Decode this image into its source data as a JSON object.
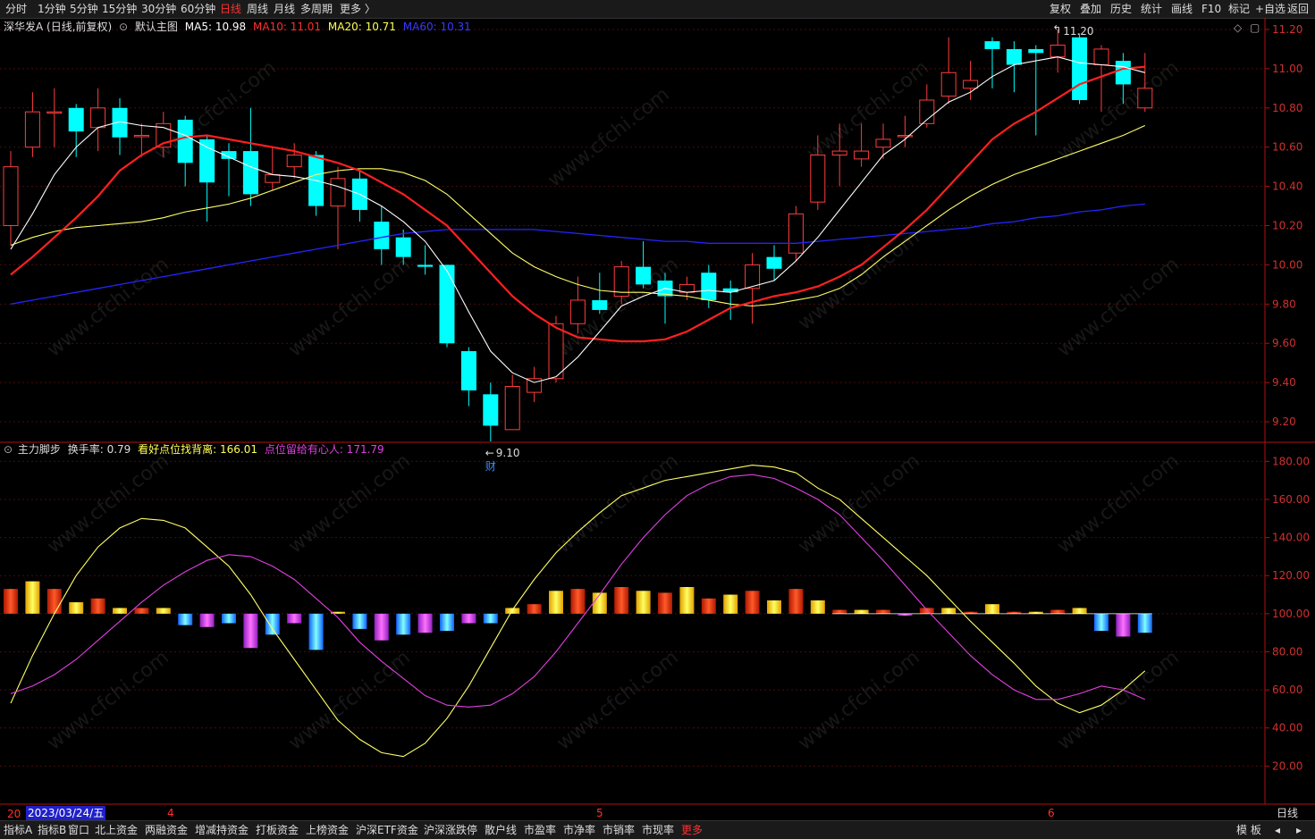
{
  "top_menu": {
    "left": [
      "分时",
      "1分钟",
      "5分钟",
      "15分钟",
      "30分钟",
      "60分钟",
      "日线",
      "周线",
      "月线",
      "多周期",
      "更多 〉"
    ],
    "active": "日线",
    "right": [
      "复权",
      "叠加",
      "历史",
      "统计",
      "画线",
      "F10",
      "标记",
      "+自选",
      "返回"
    ]
  },
  "main_legend": {
    "stock": "深华发A (日线,前复权)",
    "template": "默认主图",
    "ma5": "MA5: 10.98",
    "ma10": "MA10: 11.01",
    "ma20": "MA20: 10.71",
    "ma60": "MA60: 10.31"
  },
  "sub_legend": {
    "name": "主力脚步",
    "turnover": "换手率: 0.79",
    "line1": "看好点位找背离: 166.01",
    "line2": "点位留给有心人: 171.79"
  },
  "watermark": "www.cfchi.com",
  "price_axis": [
    "11.20",
    "11.00",
    "10.80",
    "10.60",
    "10.40",
    "10.20",
    "10.00",
    "9.80",
    "9.60",
    "9.40",
    "9.20"
  ],
  "indicator_axis": [
    "180.00",
    "160.00",
    "140.00",
    "120.00",
    "100.00",
    "80.00",
    "60.00",
    "40.00",
    "20.00"
  ],
  "annotations": {
    "high": "11.20",
    "low": "9.10",
    "event": "财"
  },
  "date_axis": {
    "cursor_date": "2023/03/24/五",
    "cursor_prefix": "20",
    "months": [
      "4",
      "5",
      "6"
    ],
    "period": "日线"
  },
  "bottom_tabs": [
    "指标A",
    "指标B",
    "窗口",
    "北上资金",
    "两融资金",
    "增减持资金",
    "打板资金",
    "上榜资金",
    "沪深ETF资金",
    "沪深涨跌停",
    "散户线",
    "市盈率",
    "市净率",
    "市销率",
    "市现率",
    "更多"
  ],
  "bottom_right": [
    "模 板",
    "◂",
    "▸"
  ],
  "colors": {
    "up": "#ff3d3d",
    "down": "#00ffff",
    "ma5": "#ffffff",
    "ma10": "#ff2020",
    "ma20": "#ffff66",
    "ma60": "#2424ff",
    "line1": "#ffff66",
    "line2": "#e040e0",
    "axis": "#b01010"
  },
  "chart_data": [
    {
      "type": "candlestick",
      "title": "深华发A (日线,前复权)",
      "ylim": [
        9.1,
        11.25
      ],
      "candles": [
        {
          "o": 10.2,
          "c": 10.5,
          "h": 10.58,
          "l": 10.1
        },
        {
          "o": 10.6,
          "c": 10.78,
          "h": 10.88,
          "l": 10.55
        },
        {
          "o": 10.78,
          "c": 10.78,
          "h": 10.9,
          "l": 10.6
        },
        {
          "o": 10.8,
          "c": 10.68,
          "h": 10.82,
          "l": 10.55
        },
        {
          "o": 10.7,
          "c": 10.8,
          "h": 10.9,
          "l": 10.58
        },
        {
          "o": 10.8,
          "c": 10.65,
          "h": 10.85,
          "l": 10.56
        },
        {
          "o": 10.66,
          "c": 10.66,
          "h": 10.72,
          "l": 10.55
        },
        {
          "o": 10.6,
          "c": 10.72,
          "h": 10.78,
          "l": 10.55
        },
        {
          "o": 10.74,
          "c": 10.52,
          "h": 10.76,
          "l": 10.4
        },
        {
          "o": 10.64,
          "c": 10.42,
          "h": 10.66,
          "l": 10.22
        },
        {
          "o": 10.58,
          "c": 10.54,
          "h": 10.62,
          "l": 10.35
        },
        {
          "o": 10.58,
          "c": 10.36,
          "h": 10.8,
          "l": 10.3
        },
        {
          "o": 10.42,
          "c": 10.46,
          "h": 10.6,
          "l": 10.38
        },
        {
          "o": 10.5,
          "c": 10.56,
          "h": 10.62,
          "l": 10.44
        },
        {
          "o": 10.56,
          "c": 10.3,
          "h": 10.58,
          "l": 10.25
        },
        {
          "o": 10.3,
          "c": 10.44,
          "h": 10.5,
          "l": 10.08
        },
        {
          "o": 10.44,
          "c": 10.28,
          "h": 10.48,
          "l": 10.22
        },
        {
          "o": 10.22,
          "c": 10.08,
          "h": 10.3,
          "l": 10.0
        },
        {
          "o": 10.14,
          "c": 10.04,
          "h": 10.18,
          "l": 10.0
        },
        {
          "o": 10.0,
          "c": 9.99,
          "h": 10.1,
          "l": 9.95
        },
        {
          "o": 10.0,
          "c": 9.6,
          "h": 10.0,
          "l": 9.58
        },
        {
          "o": 9.56,
          "c": 9.36,
          "h": 9.58,
          "l": 9.28
        },
        {
          "o": 9.34,
          "c": 9.18,
          "h": 9.4,
          "l": 9.1
        },
        {
          "o": 9.16,
          "c": 9.38,
          "h": 9.44,
          "l": 9.16
        },
        {
          "o": 9.35,
          "c": 9.42,
          "h": 9.48,
          "l": 9.3
        },
        {
          "o": 9.42,
          "c": 9.7,
          "h": 9.74,
          "l": 9.4
        },
        {
          "o": 9.7,
          "c": 9.82,
          "h": 9.94,
          "l": 9.65
        },
        {
          "o": 9.82,
          "c": 9.77,
          "h": 9.96,
          "l": 9.75
        },
        {
          "o": 9.84,
          "c": 9.99,
          "h": 10.02,
          "l": 9.8
        },
        {
          "o": 9.99,
          "c": 9.9,
          "h": 10.12,
          "l": 9.88
        },
        {
          "o": 9.92,
          "c": 9.84,
          "h": 9.96,
          "l": 9.7
        },
        {
          "o": 9.86,
          "c": 9.9,
          "h": 9.94,
          "l": 9.82
        },
        {
          "o": 9.96,
          "c": 9.82,
          "h": 10.0,
          "l": 9.78
        },
        {
          "o": 9.88,
          "c": 9.86,
          "h": 9.92,
          "l": 9.72
        },
        {
          "o": 9.88,
          "c": 10.0,
          "h": 10.06,
          "l": 9.7
        },
        {
          "o": 10.04,
          "c": 9.98,
          "h": 10.1,
          "l": 9.92
        },
        {
          "o": 10.06,
          "c": 10.26,
          "h": 10.3,
          "l": 10.02
        },
        {
          "o": 10.32,
          "c": 10.56,
          "h": 10.66,
          "l": 10.28
        },
        {
          "o": 10.56,
          "c": 10.58,
          "h": 10.72,
          "l": 10.4
        },
        {
          "o": 10.54,
          "c": 10.58,
          "h": 10.72,
          "l": 10.5
        },
        {
          "o": 10.6,
          "c": 10.64,
          "h": 10.72,
          "l": 10.54
        },
        {
          "o": 10.66,
          "c": 10.66,
          "h": 10.76,
          "l": 10.6
        },
        {
          "o": 10.72,
          "c": 10.84,
          "h": 10.92,
          "l": 10.7
        },
        {
          "o": 10.86,
          "c": 10.98,
          "h": 11.16,
          "l": 10.82
        },
        {
          "o": 10.9,
          "c": 10.94,
          "h": 11.04,
          "l": 10.84
        },
        {
          "o": 11.14,
          "c": 11.1,
          "h": 11.16,
          "l": 10.9
        },
        {
          "o": 11.1,
          "c": 11.02,
          "h": 11.14,
          "l": 10.88
        },
        {
          "o": 11.1,
          "c": 11.08,
          "h": 11.12,
          "l": 10.66
        },
        {
          "o": 11.06,
          "c": 11.12,
          "h": 11.2,
          "l": 10.98
        },
        {
          "o": 11.16,
          "c": 10.84,
          "h": 11.18,
          "l": 10.82
        },
        {
          "o": 11.02,
          "c": 11.1,
          "h": 11.12,
          "l": 10.78
        },
        {
          "o": 11.04,
          "c": 10.92,
          "h": 11.08,
          "l": 10.82
        },
        {
          "o": 10.8,
          "c": 10.9,
          "h": 11.08,
          "l": 10.78
        }
      ],
      "ma5": [
        10.08,
        10.26,
        10.46,
        10.6,
        10.7,
        10.73,
        10.71,
        10.7,
        10.66,
        10.6,
        10.55,
        10.5,
        10.46,
        10.45,
        10.43,
        10.4,
        10.36,
        10.3,
        10.22,
        10.12,
        9.97,
        9.76,
        9.56,
        9.45,
        9.4,
        9.43,
        9.53,
        9.66,
        9.79,
        9.84,
        9.88,
        9.86,
        9.87,
        9.86,
        9.89,
        9.92,
        10.02,
        10.14,
        10.28,
        10.42,
        10.56,
        10.64,
        10.74,
        10.83,
        10.88,
        10.96,
        11.02,
        11.04,
        11.06,
        11.03,
        11.02,
        11.01,
        10.98
      ],
      "ma10": [
        9.95,
        10.04,
        10.14,
        10.24,
        10.35,
        10.48,
        10.56,
        10.62,
        10.65,
        10.66,
        10.64,
        10.62,
        10.6,
        10.58,
        10.55,
        10.52,
        10.48,
        10.42,
        10.36,
        10.28,
        10.2,
        10.08,
        9.96,
        9.84,
        9.75,
        9.68,
        9.63,
        9.62,
        9.61,
        9.61,
        9.62,
        9.66,
        9.72,
        9.78,
        9.81,
        9.84,
        9.86,
        9.89,
        9.94,
        10.0,
        10.09,
        10.18,
        10.28,
        10.4,
        10.52,
        10.64,
        10.72,
        10.78,
        10.85,
        10.92,
        10.96,
        11.0,
        11.01
      ],
      "ma20": [
        10.1,
        10.14,
        10.17,
        10.19,
        10.2,
        10.21,
        10.22,
        10.24,
        10.27,
        10.29,
        10.31,
        10.34,
        10.38,
        10.42,
        10.46,
        10.48,
        10.49,
        10.49,
        10.47,
        10.43,
        10.36,
        10.26,
        10.16,
        10.06,
        9.99,
        9.94,
        9.9,
        9.87,
        9.86,
        9.86,
        9.85,
        9.84,
        9.82,
        9.8,
        9.79,
        9.8,
        9.82,
        9.84,
        9.88,
        9.95,
        10.04,
        10.12,
        10.2,
        10.28,
        10.35,
        10.41,
        10.46,
        10.5,
        10.54,
        10.58,
        10.62,
        10.66,
        10.71
      ],
      "ma60": [
        9.8,
        9.82,
        9.84,
        9.86,
        9.88,
        9.9,
        9.92,
        9.94,
        9.96,
        9.98,
        10.0,
        10.02,
        10.04,
        10.06,
        10.08,
        10.1,
        10.12,
        10.14,
        10.16,
        10.17,
        10.18,
        10.18,
        10.18,
        10.18,
        10.18,
        10.17,
        10.16,
        10.15,
        10.14,
        10.13,
        10.12,
        10.12,
        10.11,
        10.11,
        10.11,
        10.11,
        10.11,
        10.12,
        10.13,
        10.14,
        10.15,
        10.16,
        10.17,
        10.18,
        10.19,
        10.21,
        10.22,
        10.24,
        10.25,
        10.27,
        10.28,
        10.3,
        10.31
      ]
    },
    {
      "type": "bar+line",
      "title": "主力脚步",
      "ylim": [
        0,
        190
      ],
      "bars": [
        113,
        117,
        113,
        106,
        108,
        103,
        103,
        103,
        94,
        93,
        95,
        82,
        89,
        95,
        81,
        101,
        92,
        86,
        89,
        90,
        91,
        95,
        95,
        103,
        105,
        112,
        113,
        111,
        114,
        112,
        111,
        114,
        108,
        110,
        112,
        107,
        113,
        107,
        102,
        102,
        102,
        99,
        103,
        103,
        101,
        105,
        101,
        101,
        102,
        103,
        91,
        88,
        90
      ],
      "line1": [
        53,
        78,
        100,
        120,
        135,
        145,
        150,
        149,
        145,
        135,
        125,
        110,
        92,
        76,
        60,
        44,
        34,
        27,
        25,
        32,
        45,
        62,
        82,
        102,
        118,
        132,
        143,
        153,
        162,
        166,
        170,
        172,
        174,
        176,
        178,
        177,
        174,
        166,
        160,
        150,
        140,
        130,
        120,
        108,
        96,
        85,
        74,
        62,
        53,
        48,
        52,
        60,
        70
      ],
      "line2": [
        58,
        62,
        68,
        76,
        86,
        96,
        106,
        115,
        122,
        128,
        131,
        130,
        125,
        118,
        108,
        98,
        85,
        75,
        66,
        57,
        52,
        51,
        52,
        58,
        67,
        80,
        95,
        110,
        126,
        140,
        152,
        162,
        168,
        172,
        173,
        171,
        166,
        160,
        152,
        140,
        128,
        115,
        102,
        90,
        78,
        68,
        60,
        55,
        55,
        58,
        62,
        60,
        55
      ]
    }
  ]
}
